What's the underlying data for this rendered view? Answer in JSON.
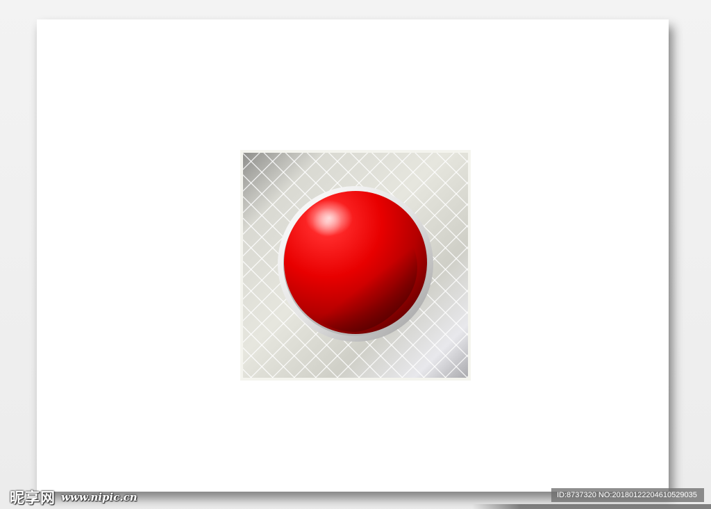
{
  "watermark": {
    "logo_text": "昵享网",
    "url_text": "www.nipic.cn",
    "id_text": "ID:8737320 NO:20180122204610529035"
  },
  "artwork": {
    "description_icon": "red-dome-button-icon",
    "colors": {
      "dome": "#e00000",
      "dome_dark": "#7a0000",
      "plate": "#dcdcd4",
      "plate_edge": "#f6f6f0",
      "grid": "#ffffff"
    }
  }
}
